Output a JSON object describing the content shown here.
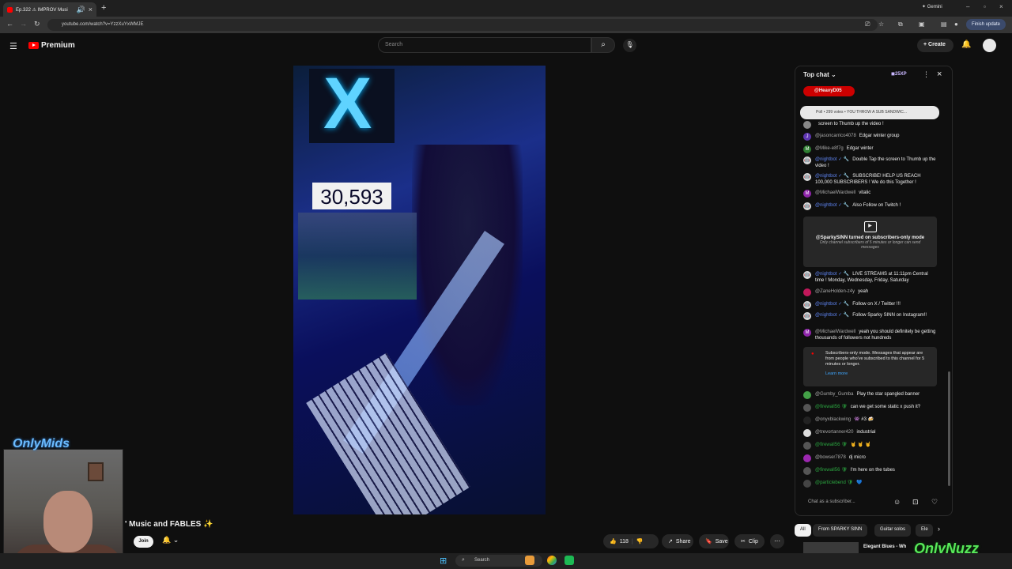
{
  "browser": {
    "tab_title": "Ep.322 ⚠ IMPROV Musi",
    "url": "youtube.com/watch?v=YzzXuYxWMJE",
    "gemini_label": "Gemini",
    "finish_update_label": "Finish update"
  },
  "youtube": {
    "logo_label": "Premium",
    "search_placeholder": "Search",
    "create_label": "Create"
  },
  "video": {
    "counter": "30,593"
  },
  "overlays": {
    "webcam_brand": "OnlyMids",
    "watermark": "OnlyNuzz"
  },
  "channel_row": {
    "title_fragment": "' Music and FABLES ✨",
    "join_label": "Join"
  },
  "actions": {
    "like_count": "118",
    "share_label": "Share",
    "save_label": "Save",
    "clip_label": "Clip"
  },
  "chat": {
    "header": "Top chat",
    "xp_badge": "25XP",
    "user_chip": "@HeavyD05",
    "poll_text": "Poll • 299 votes • YOU THROW A SUB SANDWIC...",
    "messages_top": [
      {
        "avatar": "",
        "avatar_color": "#888888",
        "user": "",
        "text": "screen to Thumb up the video !",
        "mod": false
      },
      {
        "avatar": "J",
        "avatar_color": "#5e35b1",
        "user": "@jasoncarrico4078",
        "text": "Edgar winter group",
        "mod": false
      },
      {
        "avatar": "M",
        "avatar_color": "#2e7d32",
        "user": "@Mike-e8f7g",
        "text": "Edgar winter",
        "mod": false
      },
      {
        "avatar": "🤖",
        "avatar_color": "#dddddd",
        "user": "@nightbot ✓ 🔧",
        "text": "Double Tap the screen to Thumb up the video !",
        "mod": true
      },
      {
        "avatar": "🤖",
        "avatar_color": "#dddddd",
        "user": "@nightbot ✓ 🔧",
        "text": "SUBSCRIBE! HELP US REACH 100,000 SUBSCRIBERS ! We do this Together !",
        "mod": true
      },
      {
        "avatar": "M",
        "avatar_color": "#8e24aa",
        "user": "@MichaelWardwell",
        "text": "vitalic",
        "mod": false
      },
      {
        "avatar": "🤖",
        "avatar_color": "#dddddd",
        "user": "@nightbot ✓ 🔧",
        "text": "Also Follow on Twitch !",
        "mod": true
      }
    ],
    "subscribers_mode": {
      "title": "@SparkySINN turned on subscribers-only mode",
      "subtitle": "Only channel subscribers of 5 minutes or longer can send messages"
    },
    "messages_mid": [
      {
        "avatar": "🤖",
        "avatar_color": "#dddddd",
        "user": "@nightbot ✓ 🔧",
        "text": "LIVE STREAMS at 11:11pm Central time ! Monday, Wednesday, Friday, Saturday",
        "mod": true
      },
      {
        "avatar": "",
        "avatar_color": "#c2185b",
        "user": "@ZaneHolden-z4y",
        "text": "yeah",
        "mod": false
      },
      {
        "avatar": "🤖",
        "avatar_color": "#dddddd",
        "user": "@nightbot ✓ 🔧",
        "text": "Follow on X / Twitter !!!",
        "mod": true
      },
      {
        "avatar": "🤖",
        "avatar_color": "#dddddd",
        "user": "@nightbot ✓ 🔧",
        "text": "Follow Sparky SINN on Instagram!!",
        "mod": true
      },
      {
        "avatar": "M",
        "avatar_color": "#8e24aa",
        "user": "@MichaelWardwell",
        "text": "yeah you should definitely be getting thousands of followers not hundreds",
        "mod": false
      }
    ],
    "notice": {
      "text": "Subscribers-only mode. Messages that appear are from people who've subscribed to this channel for 5 minutes or longer.",
      "learn_more": "Learn more"
    },
    "messages_bottom": [
      {
        "avatar": "",
        "avatar_color": "#43a047",
        "user": "@Gumby_Gumba",
        "text": "Play the star spangled banner",
        "mod": false,
        "green": false
      },
      {
        "avatar": "",
        "avatar_color": "#555555",
        "user": "@firewall56 🛡",
        "text": "can we get some static x push it?",
        "mod": false,
        "green": true
      },
      {
        "avatar": "",
        "avatar_color": "#222222",
        "user": "@onyxblackwing",
        "text": "👾 #3 🍻",
        "mod": false,
        "green": false
      },
      {
        "avatar": "",
        "avatar_color": "#dddddd",
        "user": "@trevortanner420",
        "text": "industrial",
        "mod": false,
        "green": false
      },
      {
        "avatar": "",
        "avatar_color": "#555555",
        "user": "@firewall56 🛡",
        "text": "🤘 🤘 🤘",
        "mod": false,
        "green": true
      },
      {
        "avatar": "",
        "avatar_color": "#9c27b0",
        "user": "@bowser7878",
        "text": "dj micro",
        "mod": false,
        "green": false
      },
      {
        "avatar": "",
        "avatar_color": "#555555",
        "user": "@firewall56 🛡",
        "text": "I'm here on the tubes",
        "mod": false,
        "green": true
      },
      {
        "avatar": "",
        "avatar_color": "#444444",
        "user": "@particlebend 🛡",
        "text": "💙",
        "mod": false,
        "green": true
      }
    ],
    "input_placeholder": "Chat as a subscriber..."
  },
  "chips": [
    "All",
    "From SPARKY SINN",
    "Guitar solos",
    "Ele"
  ],
  "recommendation_title": "Elegant Blues - Wh",
  "taskbar": {
    "search_label": "Search",
    "time": "",
    "date": ""
  },
  "colors": {
    "accent_red": "#ff0000",
    "mod_blue": "#5e84f1",
    "member_green": "#2ba640"
  }
}
